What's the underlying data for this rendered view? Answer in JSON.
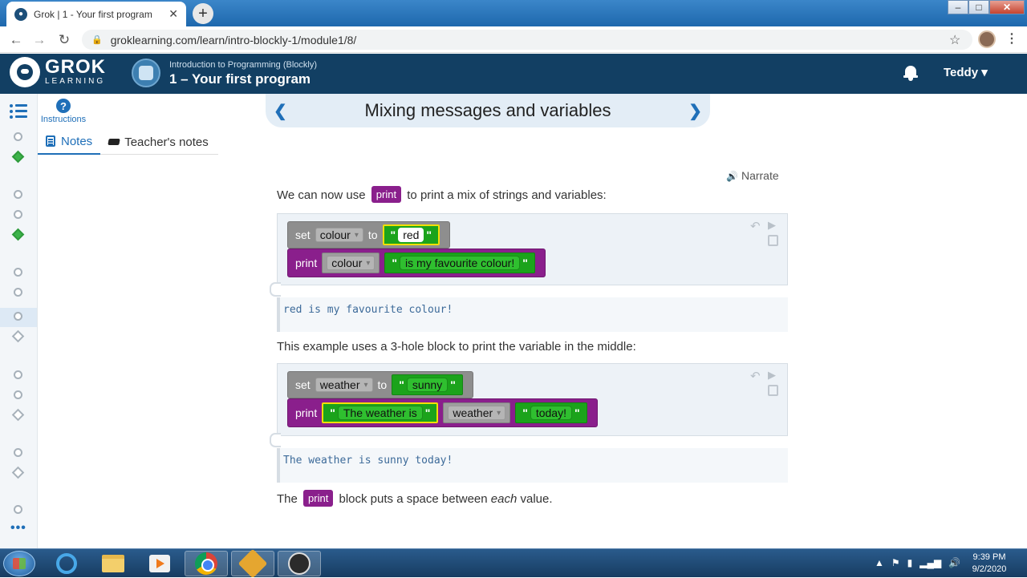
{
  "browser": {
    "tab_title": "Grok | 1 - Your first program",
    "url": "groklearning.com/learn/intro-blockly-1/module1/8/"
  },
  "header": {
    "logo_top": "GROK",
    "logo_bottom": "LEARNING",
    "course_subtitle": "Introduction to Programming (Blockly)",
    "course_title": "1 – Your first program",
    "user": "Teddy ▾"
  },
  "rail": {
    "instructions_label": "Instructions"
  },
  "lesson": {
    "title": "Mixing messages and variables",
    "tabs": [
      "Notes",
      "Teacher's notes"
    ],
    "narrate": "Narrate",
    "para1_before": "We can now use",
    "para1_kw": "print",
    "para1_after": "to print a mix of strings and variables:",
    "example1": {
      "set_label": "set",
      "var": "colour",
      "to_label": "to",
      "value": "red",
      "print_label": "print",
      "print_var": "colour",
      "print_text": "is my favourite colour!",
      "output": "red is my favourite colour!"
    },
    "para2": "This example uses a 3-hole block to print the variable in the middle:",
    "example2": {
      "set_label": "set",
      "var": "weather",
      "to_label": "to",
      "value": "sunny",
      "print_label": "print",
      "text1": "The weather is",
      "print_var": "weather",
      "text2": "today!",
      "output": "The weather is sunny today!"
    },
    "para3_before": "The",
    "para3_kw": "print",
    "para3_after": "block puts a space between",
    "para3_em": "each",
    "para3_end": "value."
  },
  "taskbar": {
    "time": "9:39 PM",
    "date": "9/2/2020"
  }
}
